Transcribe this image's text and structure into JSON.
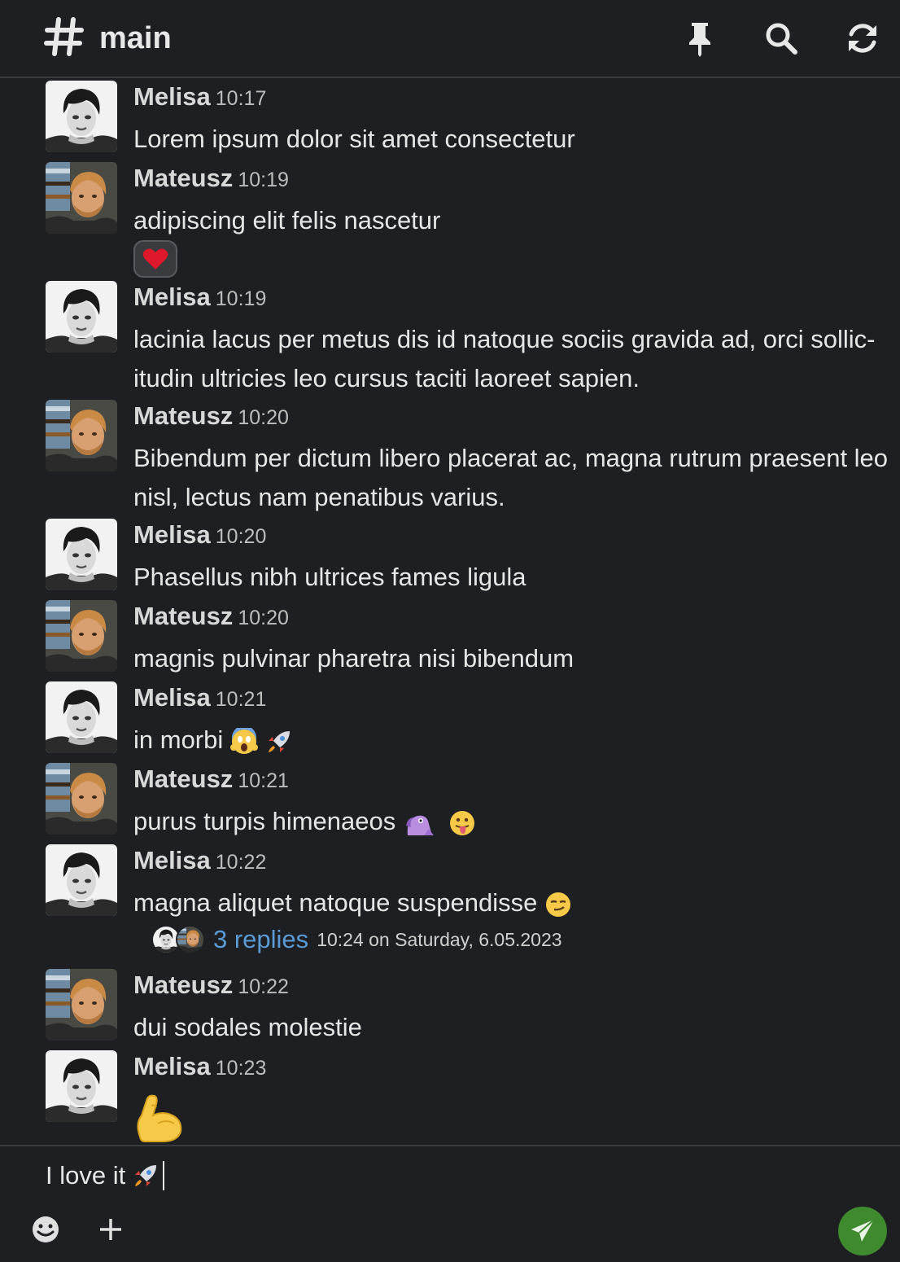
{
  "header": {
    "channel_name": "main"
  },
  "messages": [
    {
      "author": "Melisa",
      "time": "10:17",
      "text": "Lorem ipsum dolor sit amet consectetur"
    },
    {
      "author": "Mateusz",
      "time": "10:19",
      "text": "adipiscing elit felis nascetur",
      "reaction": "heart"
    },
    {
      "author": "Melisa",
      "time": "10:19",
      "text": "lacinia lacus per metus dis id natoque sociis gravida ad, orci sollic-itudin ultricies leo cursus taciti laoreet sapien."
    },
    {
      "author": "Mateusz",
      "time": "10:20",
      "text": "Bibendum per dictum libero placerat ac, magna rutrum praesent leo nisl, lectus nam penatibus varius."
    },
    {
      "author": "Melisa",
      "time": "10:20",
      "text": "Phasellus nibh ultrices fames ligula"
    },
    {
      "author": "Mateusz",
      "time": "10:20",
      "text": "magnis pulvinar pharetra nisi bibendum"
    },
    {
      "author": "Melisa",
      "time": "10:21",
      "text": "in morbi"
    },
    {
      "author": "Mateusz",
      "time": "10:21",
      "text": "purus turpis himenaeos"
    },
    {
      "author": "Melisa",
      "time": "10:22",
      "text": "magna aliquet natoque suspendisse"
    },
    {
      "author": "Mateusz",
      "time": "10:22",
      "text": "dui sodales molestie"
    },
    {
      "author": "Melisa",
      "time": "10:23",
      "text": ""
    }
  ],
  "thread": {
    "replies_label": "3 replies",
    "last_reply": "10:24 on Saturday, 6.05.2023"
  },
  "composer": {
    "text": "I love it"
  },
  "icons": {
    "header": [
      "hash-icon",
      "pin-icon",
      "search-icon",
      "refresh-icon"
    ],
    "composer": [
      "emoji-icon",
      "plus-icon",
      "send-icon"
    ]
  },
  "colors": {
    "background": "#1e1f22",
    "link": "#5b9bd5",
    "send_button": "#3f8a2e"
  }
}
